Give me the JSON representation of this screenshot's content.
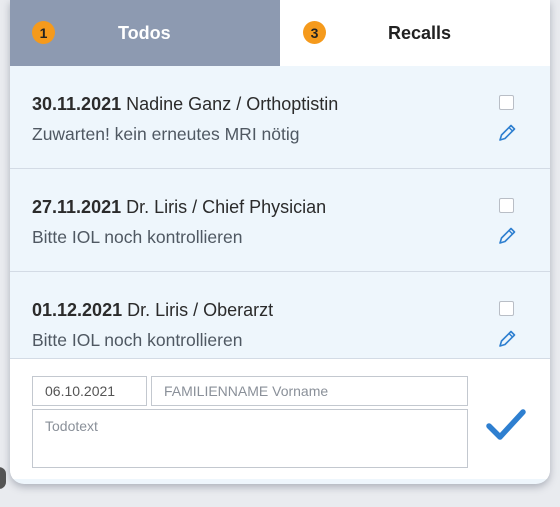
{
  "tabs": [
    {
      "badge": "1",
      "label": "Todos"
    },
    {
      "badge": "3",
      "label": "Recalls"
    }
  ],
  "items": [
    {
      "date": "30.11.2021",
      "person": "Nadine Ganz / Orthoptistin",
      "text": "Zuwarten! kein erneutes MRI nötig"
    },
    {
      "date": "27.11.2021",
      "person": "Dr. Liris / Chief Physician",
      "text": "Bitte IOL noch kontrollieren"
    },
    {
      "date": "01.12.2021",
      "person": "Dr. Liris / Oberarzt",
      "text": "Bitte IOL noch kontrollieren"
    }
  ],
  "form": {
    "date_value": "06.10.2021",
    "name_placeholder": "FAMILIENNAME Vorname",
    "text_placeholder": "Todotext"
  },
  "icons": {
    "edit": "pencil-icon",
    "submit": "checkmark-icon"
  },
  "colors": {
    "accent": "#2e7fd0",
    "badge": "#f59a1c",
    "inactive_tab": "#8d9ab1"
  }
}
